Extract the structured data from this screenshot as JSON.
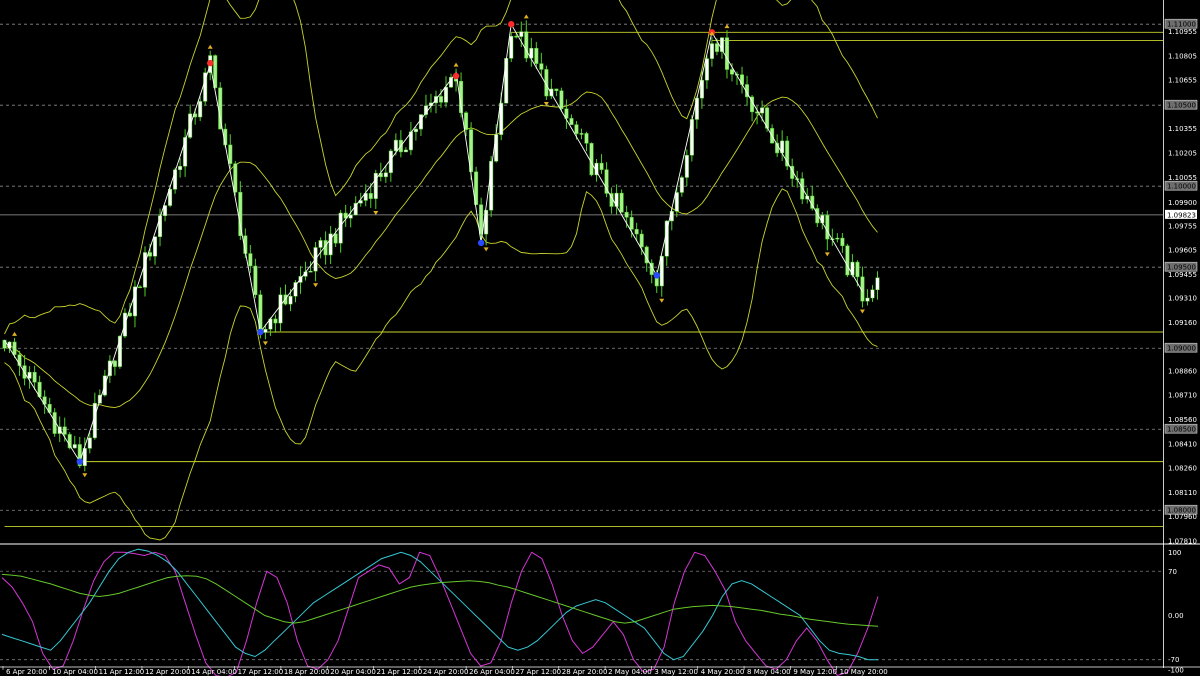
{
  "chart_data": [
    {
      "type": "candlestick",
      "title": "",
      "xlabel": "",
      "ylabel": "",
      "ylim": [
        1.0781,
        1.111
      ],
      "grid": false,
      "price_axis_labels": [
        "1.10955",
        "1.10805",
        "1.10655",
        "1.10355",
        "1.10205",
        "1.10055",
        "1.09900",
        "1.09755",
        "1.09605",
        "1.09455",
        "1.09310",
        "1.09160",
        "1.08860",
        "1.08710",
        "1.08560",
        "1.08410",
        "1.08260",
        "1.08110",
        "1.07960",
        "1.07810"
      ],
      "level_labels": [
        "1.11000",
        "1.10500",
        "1.10000",
        "1.09500",
        "1.09000",
        "1.08500",
        "1.08000"
      ],
      "current_price": "1.09823",
      "time_labels": [
        "6 Apr 20:00",
        "10 Apr 04:00",
        "11 Apr 12:00",
        "12 Apr 20:00",
        "14 Apr 04:00",
        "17 Apr 12:00",
        "18 Apr 20:00",
        "20 Apr 04:00",
        "21 Apr 12:00",
        "24 Apr 20:00",
        "26 Apr 04:00",
        "27 Apr 12:00",
        "28 Apr 20:00",
        "2 May 04:00",
        "3 May 12:00",
        "4 May 20:00",
        "8 May 04:00",
        "9 May 12:00",
        "10 May 20:00"
      ],
      "zigzag": [
        {
          "bar": 0,
          "price": 1.0905
        },
        {
          "bar": 15,
          "price": 1.083
        },
        {
          "bar": 41,
          "price": 1.1075
        },
        {
          "bar": 51,
          "price": 1.091
        },
        {
          "bar": 90,
          "price": 1.107
        },
        {
          "bar": 95,
          "price": 1.0965
        },
        {
          "bar": 101,
          "price": 1.11
        },
        {
          "bar": 130,
          "price": 1.0945
        },
        {
          "bar": 141,
          "price": 1.1095
        },
        {
          "bar": 171,
          "price": 1.0935
        }
      ],
      "swing_highs": [
        {
          "bar": 41,
          "price": 1.1076
        },
        {
          "bar": 90,
          "price": 1.1068
        },
        {
          "bar": 101,
          "price": 1.11
        },
        {
          "bar": 141,
          "price": 1.1095
        }
      ],
      "swing_lows": [
        {
          "bar": 15,
          "price": 1.083
        },
        {
          "bar": 51,
          "price": 1.091
        },
        {
          "bar": 95,
          "price": 1.0965
        },
        {
          "bar": 130,
          "price": 1.0945
        }
      ],
      "horizontal_lines": [
        {
          "price": 1.1095,
          "from_bar": 101,
          "color": "#c8d42a"
        },
        {
          "price": 1.109,
          "from_bar": 141,
          "color": "#c8d42a"
        },
        {
          "price": 1.091,
          "from_bar": 51,
          "color": "#c8d42a"
        },
        {
          "price": 1.083,
          "from_bar": 15,
          "color": "#c8d42a"
        },
        {
          "price": 1.079,
          "from_bar": 0,
          "color": "#c8d42a"
        }
      ],
      "colors": {
        "background": "#000000",
        "candle_up": "#ffffff",
        "candle_down": "#a6f28a",
        "candle_wick": "#4fd12a",
        "bollinger": "#c8d42a",
        "zigzag": "#ffffff",
        "swing_high_dot": "#ff2a2a",
        "swing_low_dot": "#2a4aff",
        "arrow": "#e0b020",
        "level_line": "#8a8a8a"
      }
    },
    {
      "type": "line",
      "title": "",
      "ylim": [
        -80,
        110
      ],
      "axis_labels": [
        "100",
        "70",
        "0.00",
        "-70",
        "-100"
      ],
      "series": [
        {
          "color": "#d436d4",
          "values": [
            60,
            45,
            20,
            -10,
            -60,
            -85,
            -80,
            -40,
            10,
            55,
            85,
            100,
            100,
            98,
            95,
            100,
            95,
            70,
            20,
            -30,
            -75,
            -95,
            -98,
            -90,
            -40,
            20,
            70,
            60,
            20,
            -40,
            -80,
            -85,
            -70,
            -40,
            10,
            60,
            70,
            80,
            75,
            50,
            60,
            100,
            95,
            60,
            20,
            -20,
            -60,
            -80,
            -75,
            -40,
            20,
            70,
            100,
            90,
            50,
            0,
            -40,
            -60,
            -50,
            -30,
            -10,
            -30,
            -70,
            -90,
            -85,
            -50,
            20,
            70,
            100,
            95,
            70,
            40,
            -10,
            -40,
            -60,
            -80,
            -85,
            -70,
            -40,
            -20,
            -40,
            -70,
            -95,
            -90,
            -60,
            -20,
            30
          ]
        },
        {
          "color": "#36c8d4",
          "values": [
            -30,
            -35,
            -40,
            -45,
            -50,
            -55,
            -40,
            -20,
            0,
            20,
            45,
            70,
            90,
            100,
            105,
            102,
            95,
            85,
            70,
            50,
            30,
            10,
            -10,
            -30,
            -50,
            -60,
            -65,
            -55,
            -40,
            -25,
            -10,
            5,
            20,
            30,
            40,
            50,
            60,
            70,
            80,
            90,
            95,
            100,
            95,
            85,
            70,
            55,
            40,
            25,
            10,
            -5,
            -20,
            -35,
            -50,
            -55,
            -50,
            -40,
            -25,
            -10,
            5,
            15,
            20,
            25,
            20,
            10,
            0,
            -10,
            -20,
            -40,
            -60,
            -70,
            -65,
            -45,
            -25,
            0,
            30,
            50,
            55,
            50,
            40,
            30,
            20,
            10,
            0,
            -20,
            -40,
            -55,
            -60,
            -62,
            -65,
            -70,
            -70
          ]
        },
        {
          "color": "#66c82a",
          "values": [
            65,
            64,
            62,
            58,
            54,
            50,
            45,
            40,
            35,
            32,
            30,
            32,
            35,
            40,
            45,
            50,
            55,
            60,
            62,
            63,
            62,
            58,
            50,
            40,
            30,
            20,
            10,
            0,
            -5,
            -10,
            -12,
            -10,
            -5,
            0,
            5,
            10,
            15,
            20,
            25,
            30,
            35,
            40,
            45,
            48,
            50,
            52,
            53,
            54,
            55,
            54,
            52,
            48,
            45,
            40,
            35,
            30,
            25,
            20,
            15,
            10,
            5,
            0,
            -5,
            -10,
            -12,
            -10,
            -5,
            0,
            5,
            10,
            12,
            14,
            15,
            16,
            15,
            14,
            12,
            10,
            8,
            5,
            2,
            0,
            -3,
            -6,
            -8,
            -10,
            -12,
            -14,
            -15,
            -16,
            -17
          ]
        }
      ]
    }
  ]
}
